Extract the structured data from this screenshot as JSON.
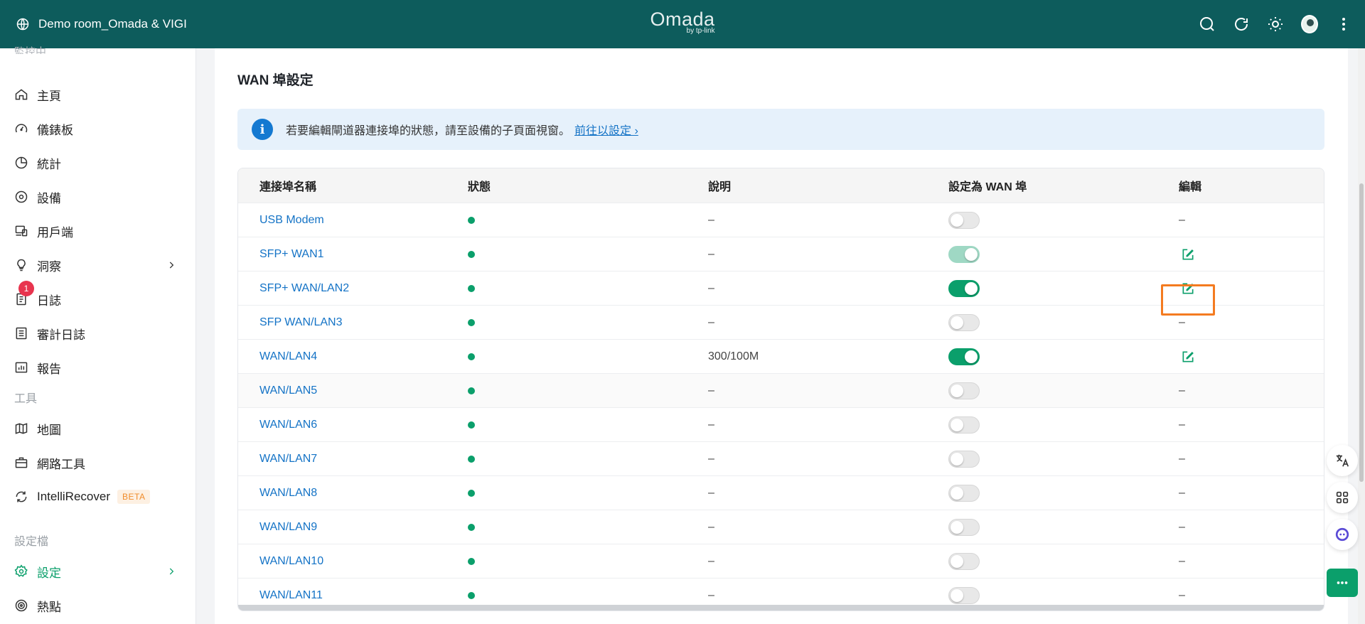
{
  "header": {
    "site_name": "Demo room_Omada & VIGI",
    "brand": "Omada",
    "brand_sub": "by tp-link"
  },
  "sidebar": {
    "cut_label": "監控中",
    "items": [
      {
        "label": "主頁",
        "icon": "home-icon"
      },
      {
        "label": "儀錶板",
        "icon": "gauge-icon"
      },
      {
        "label": "統計",
        "icon": "pie-chart-icon"
      },
      {
        "label": "設備",
        "icon": "device-icon"
      },
      {
        "label": "用戶端",
        "icon": "client-icon"
      },
      {
        "label": "洞察",
        "icon": "bulb-icon"
      },
      {
        "label": "日誌",
        "icon": "log-icon",
        "badge": "1"
      },
      {
        "label": "審計日誌",
        "icon": "audit-log-icon"
      },
      {
        "label": "報告",
        "icon": "report-icon"
      }
    ],
    "tools_label": "工具",
    "tools": [
      {
        "label": "地圖"
      },
      {
        "label": "網路工具"
      },
      {
        "label": "IntelliRecover",
        "badge": "BETA"
      }
    ],
    "profile_label": "設定檔",
    "profile": [
      {
        "label": "設定"
      },
      {
        "label": "熱點"
      }
    ]
  },
  "main": {
    "title": "WAN 埠設定",
    "notice": {
      "text": "若要編輯閘道器連接埠的狀態，請至設備的子頁面視窗。",
      "link": "前往以設定 ›"
    },
    "table": {
      "headers": [
        "連接埠名稱",
        "狀態",
        "說明",
        "設定為 WAN 埠",
        "編輯"
      ],
      "rows": [
        {
          "name": "USB Modem",
          "desc": "–",
          "wan": "off",
          "edit": "–"
        },
        {
          "name": "SFP+ WAN1",
          "desc": "–",
          "wan": "on-disabled",
          "edit": "icon"
        },
        {
          "name": "SFP+ WAN/LAN2",
          "desc": "–",
          "wan": "on",
          "edit": "icon-highlight"
        },
        {
          "name": "SFP WAN/LAN3",
          "desc": "–",
          "wan": "off",
          "edit": "–"
        },
        {
          "name": "WAN/LAN4",
          "desc": "300/100M",
          "wan": "on",
          "edit": "icon"
        },
        {
          "name": "WAN/LAN5",
          "desc": "–",
          "wan": "off",
          "edit": "–"
        },
        {
          "name": "WAN/LAN6",
          "desc": "–",
          "wan": "off",
          "edit": "–"
        },
        {
          "name": "WAN/LAN7",
          "desc": "–",
          "wan": "off",
          "edit": "–"
        },
        {
          "name": "WAN/LAN8",
          "desc": "–",
          "wan": "off",
          "edit": "–"
        },
        {
          "name": "WAN/LAN9",
          "desc": "–",
          "wan": "off",
          "edit": "–"
        },
        {
          "name": "WAN/LAN10",
          "desc": "–",
          "wan": "off",
          "edit": "–"
        },
        {
          "name": "WAN/LAN11",
          "desc": "–",
          "wan": "off",
          "edit": "–"
        }
      ]
    }
  },
  "colors": {
    "header_bg": "#0d5c5c",
    "accent": "#0b9f6b",
    "link": "#1473c6",
    "highlight": "#f47b20"
  }
}
